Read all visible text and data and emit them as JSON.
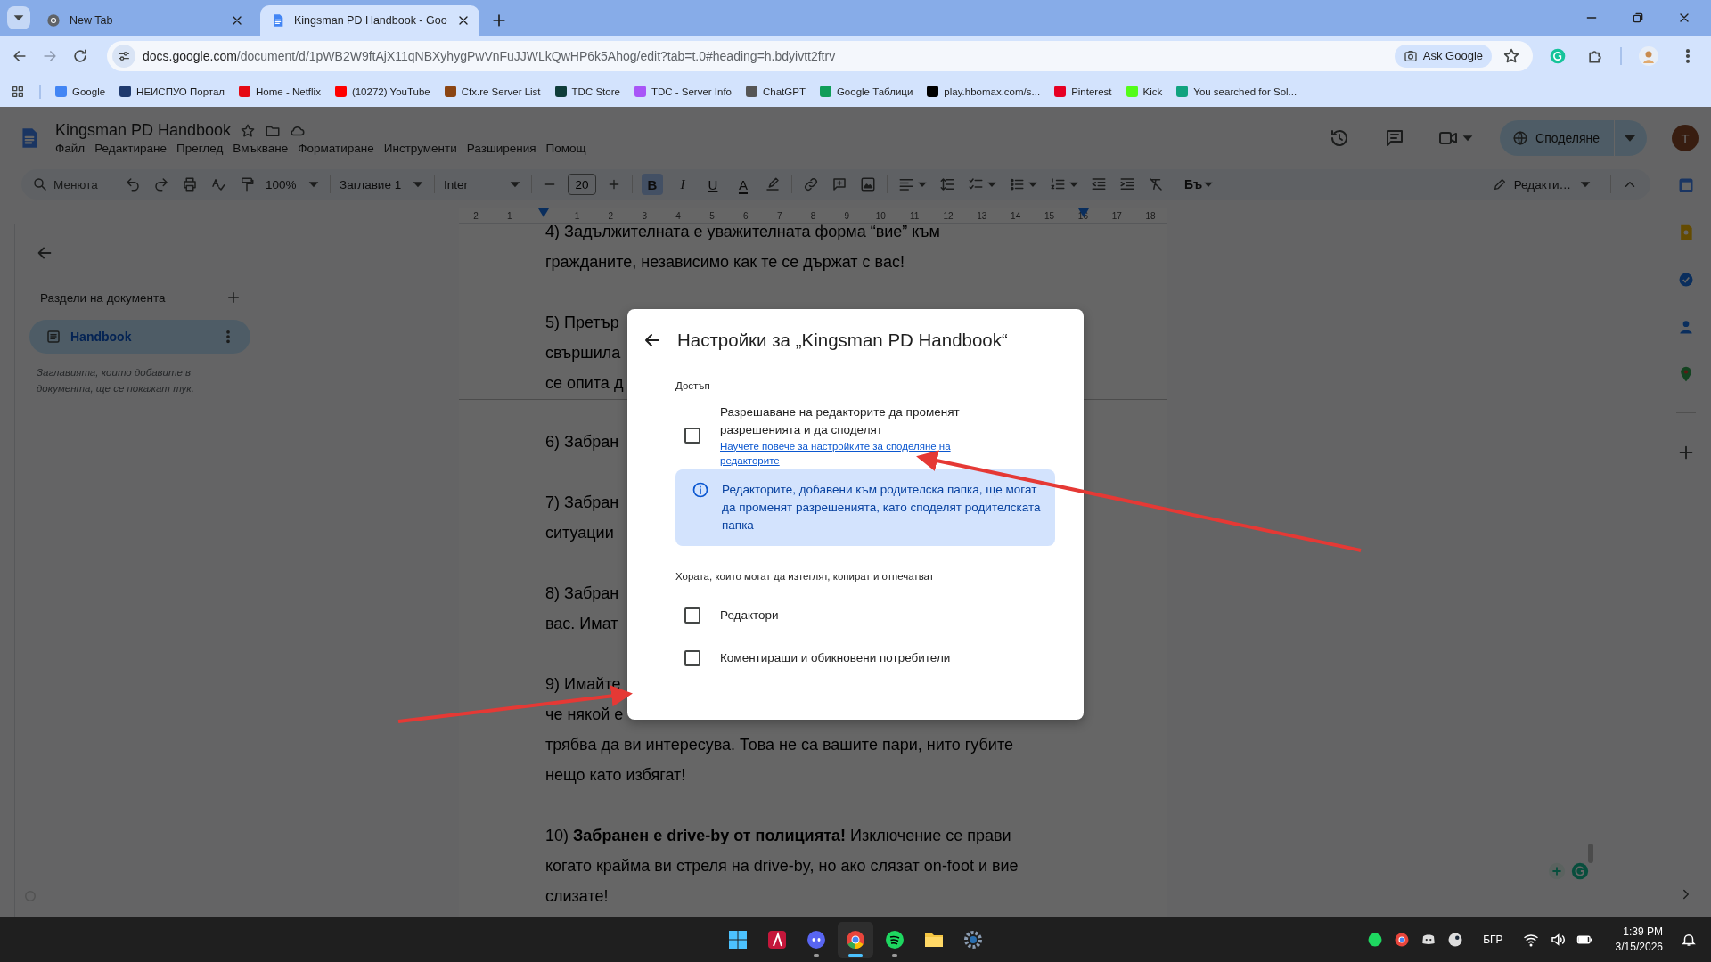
{
  "browser": {
    "tabs": [
      {
        "title": "New Tab",
        "selected": false
      },
      {
        "title": "Kingsman PD Handbook - Goo",
        "selected": true
      }
    ],
    "address": {
      "host": "docs.google.com",
      "path": "/document/d/1pWB2W9ftAjX11qNBXyhygPwVnFuJJWLkQwHP6k5Ahog/edit?tab=t.0#heading=h.bdyivtt2ftrv"
    },
    "ask_button": "Ask Google",
    "bookmarks": [
      {
        "label": "Google",
        "color": "#4285f4"
      },
      {
        "label": "НЕИСПУО Портал",
        "color": "#1f3a6e"
      },
      {
        "label": "Home - Netflix",
        "color": "#e50914"
      },
      {
        "label": "(10272) YouTube",
        "color": "#ff0000"
      },
      {
        "label": "Cfx.re Server List",
        "color": "#8b4513"
      },
      {
        "label": "TDC Store",
        "color": "#0f3d3a"
      },
      {
        "label": "TDC - Server Info",
        "color": "#a855f7"
      },
      {
        "label": "ChatGPT",
        "color": "#555555"
      },
      {
        "label": "Google Таблици",
        "color": "#0f9d58"
      },
      {
        "label": "play.hbomax.com/s...",
        "color": "#000000"
      },
      {
        "label": "Pinterest",
        "color": "#e60023"
      },
      {
        "label": "Kick",
        "color": "#53fc18"
      },
      {
        "label": "You searched for Sol...",
        "color": "#10a37f"
      }
    ]
  },
  "docs": {
    "title": "Kingsman PD Handbook",
    "menu": [
      "Файл",
      "Редактиране",
      "Преглед",
      "Вмъкване",
      "Форматиране",
      "Инструменти",
      "Разширения",
      "Помощ"
    ],
    "share_button": "Споделяне",
    "avatar": "T",
    "toolbar": {
      "search_placeholder": "Менюта",
      "zoom": "100%",
      "style": "Заглавие 1",
      "font": "Inter",
      "font_size": "20",
      "format": [
        {
          "label": "B",
          "selected": true
        },
        {
          "label": "I",
          "selected": false
        },
        {
          "label": "U",
          "selected": false
        }
      ],
      "text_color": "A",
      "input_tools": "Бъ",
      "mode": "Редакти…"
    },
    "ruler": [
      "2",
      "1",
      "1",
      "2",
      "3",
      "4",
      "5",
      "6",
      "7",
      "8",
      "9",
      "10",
      "11",
      "12",
      "13",
      "14",
      "15",
      "16",
      "17",
      "18"
    ],
    "outline": {
      "heading": "Раздели на документа",
      "tabs": [
        {
          "label": "Handbook",
          "selected": true
        }
      ],
      "hint": "Заглавията, които добавите в документа, ще се покажат тук."
    },
    "pages": [
      {
        "paragraphs": [
          {
            "lines": [
              "4) Задължителната е уважителната форма “вие” към",
              "гражданите, независимо как те се държат с вас!"
            ]
          },
          {
            "lines": [
              "5) Претър",
              "свършила",
              "се опита д"
            ]
          }
        ]
      },
      {
        "paragraphs": [
          {
            "lines": [
              "6) Забран"
            ]
          },
          {
            "lines": [
              "7) Забран",
              "ситуации"
            ]
          },
          {
            "lines": [
              "8) Забран",
              "вас. Имат"
            ]
          },
          {
            "lines": [
              "9) Имайте",
              "че някой е",
              "трябва да ви интересува. Това не са вашите пари, нито губите",
              "нещо като избягат!"
            ]
          },
          {
            "lines": [
              "10) **Забранен е drive-by от полицията!** Изключение се прави",
              "когато крайма ви стреля на drive-by, но ако слязат on-foot и вие",
              "слизате!"
            ]
          }
        ]
      }
    ]
  },
  "dialog": {
    "title": "Настройки за „Kingsman PD Handbook“",
    "access_heading": "Достъп",
    "access": {
      "label": "Разрешаване на редакторите да променят разрешенията и да споделят",
      "link": "Научете повече за настройките за споделяне на редакторите",
      "checked": false
    },
    "info": "Редакторите, добавени към родителска папка, ще могат да променят разрешенията, като споделят родителската папка",
    "download_heading": "Хората, които могат да изтеглят, копират и отпечатват",
    "download_options": [
      {
        "label": "Редактори",
        "checked": false
      },
      {
        "label": "Коментиращи и обикновени потребители",
        "checked": false
      }
    ]
  },
  "taskbar": {
    "apps": [
      {
        "kind": "start",
        "selected": false,
        "running": false
      },
      {
        "kind": "affinity",
        "selected": false,
        "running": false
      },
      {
        "kind": "discord",
        "selected": false,
        "running": true
      },
      {
        "kind": "chrome",
        "selected": true,
        "running": true
      },
      {
        "kind": "spotify",
        "selected": false,
        "running": true
      },
      {
        "kind": "explorer",
        "selected": false,
        "running": false
      },
      {
        "kind": "settings",
        "selected": false,
        "running": false
      }
    ],
    "language": "БГР",
    "time": "1:39 PM",
    "date": "3/15/2026"
  }
}
